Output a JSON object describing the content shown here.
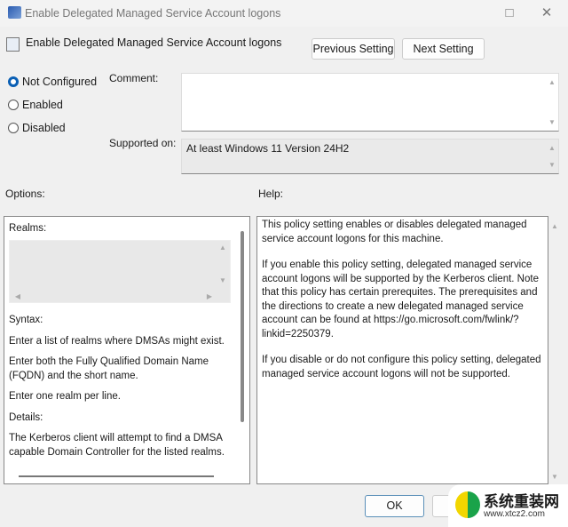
{
  "window": {
    "title": "Enable Delegated Managed Service Account logons",
    "maximize_icon": "□",
    "close_icon": "✕"
  },
  "policy": {
    "title": "Enable Delegated Managed Service Account logons"
  },
  "nav": {
    "previous": "Previous Setting",
    "next": "Next Setting"
  },
  "state": {
    "options": [
      "Not Configured",
      "Enabled",
      "Disabled"
    ],
    "selected": "Not Configured"
  },
  "comment": {
    "label": "Comment:",
    "value": ""
  },
  "supported": {
    "label": "Supported on:",
    "value": "At least Windows 11 Version 24H2"
  },
  "options": {
    "label": "Options:",
    "realms_label": "Realms:",
    "syntax": "Syntax:",
    "p1": "Enter a list of realms where DMSAs might exist.",
    "p2": "Enter both the Fully Qualified Domain Name (FQDN) and the short name.",
    "p3": "Enter one realm per line.",
    "details": "Details:",
    "p4": "The Kerberos client will attempt to find a DMSA capable Domain Controller for the listed realms."
  },
  "help": {
    "label": "Help:",
    "p1": "This policy setting enables or disables delegated managed service account logons for this machine.",
    "p2": "If you enable this policy setting, delegated managed service account logons will be supported by the Kerberos client. Note that this policy has certain prerequites. The prerequisites and the directions to create a new delegated managed service account can be found at https://go.microsoft.com/fwlink/?linkid=2250379.",
    "p3": "If you disable or do not configure this policy setting, delegated managed service account logons will not be supported."
  },
  "footer": {
    "ok": "OK"
  },
  "watermark": {
    "name": "系统重装网",
    "url": "www.xtcz2.com"
  }
}
